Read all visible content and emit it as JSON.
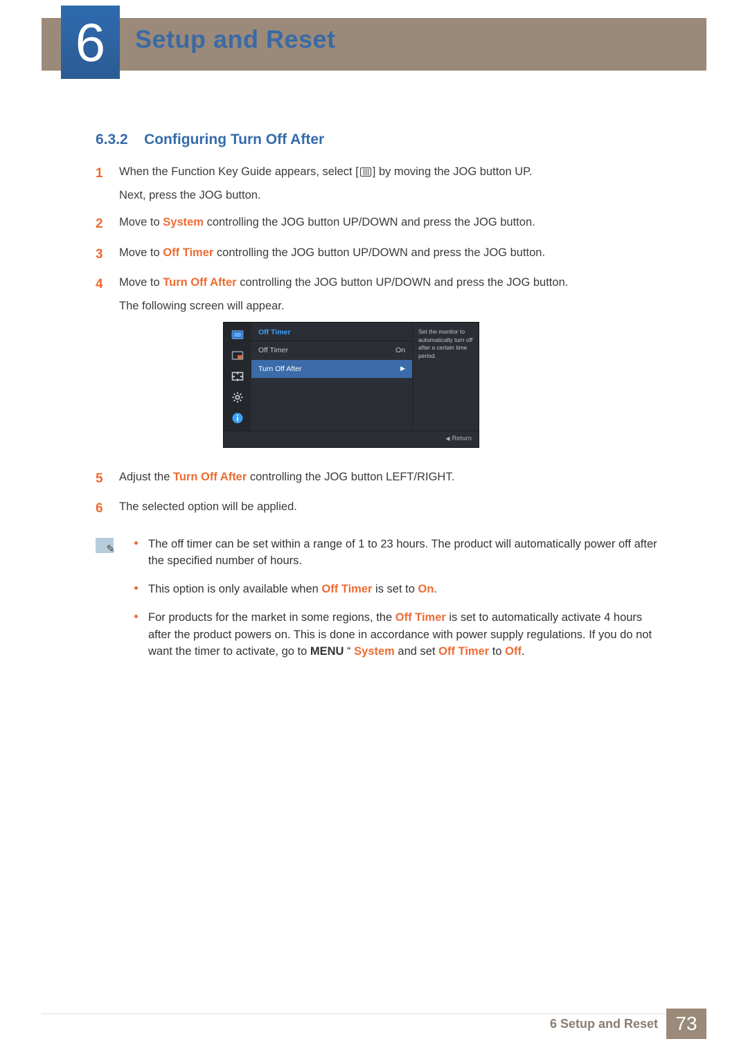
{
  "chapter": {
    "number": "6",
    "title": "Setup and Reset"
  },
  "section": {
    "number": "6.3.2",
    "title": "Configuring Turn Off After"
  },
  "steps": [
    {
      "num": "1",
      "parts": [
        "When the Function Key Guide appears, select [",
        "] by moving the JOG button UP."
      ],
      "sub": "Next, press the JOG button."
    },
    {
      "num": "2",
      "parts": [
        "Move to ",
        "System",
        " controlling the JOG button UP/DOWN and press the JOG button."
      ],
      "hl": [
        1
      ]
    },
    {
      "num": "3",
      "parts": [
        "Move to ",
        "Off Timer",
        " controlling the JOG button UP/DOWN and press the JOG button."
      ],
      "hl": [
        1
      ]
    },
    {
      "num": "4",
      "parts": [
        "Move to ",
        "Turn Off After",
        " controlling the JOG button UP/DOWN and press the JOG button."
      ],
      "hl": [
        1
      ],
      "sub": "The following screen will appear."
    },
    {
      "num": "5",
      "parts": [
        "Adjust the ",
        "Turn Off After",
        " controlling the JOG button LEFT/RIGHT."
      ],
      "hl": [
        1
      ]
    },
    {
      "num": "6",
      "parts": [
        "The selected option will be applied."
      ]
    }
  ],
  "osd": {
    "header": "Off Timer",
    "rows": [
      {
        "label": "Off Timer",
        "value": "On",
        "selected": false
      },
      {
        "label": "Turn Off After",
        "value": "▶",
        "selected": true
      }
    ],
    "desc": "Set the monitor to automatically turn off after a certain time period.",
    "return": "Return"
  },
  "notes": [
    {
      "text": "The off timer can be set within a range of 1 to 23 hours. The product will automatically power off after the specified number of hours."
    },
    {
      "parts": [
        "This option is only available when ",
        "Off Timer",
        " is set to ",
        "On",
        "."
      ],
      "hl": [
        1,
        3
      ]
    },
    {
      "parts": [
        "For products for the market in some regions, the ",
        "Off Timer",
        " is set to automatically activate 4 hours after the product powers on. This is done in accordance with power supply regulations. If you do not want the timer to activate, go to ",
        "MENU",
        "   “   ",
        "System",
        " and set ",
        "Off Timer",
        " to ",
        "Off",
        "."
      ],
      "hl": [
        1,
        5,
        7,
        9
      ],
      "boldDark": [
        3
      ]
    }
  ],
  "footer": {
    "text": "6 Setup and Reset",
    "page": "73"
  }
}
